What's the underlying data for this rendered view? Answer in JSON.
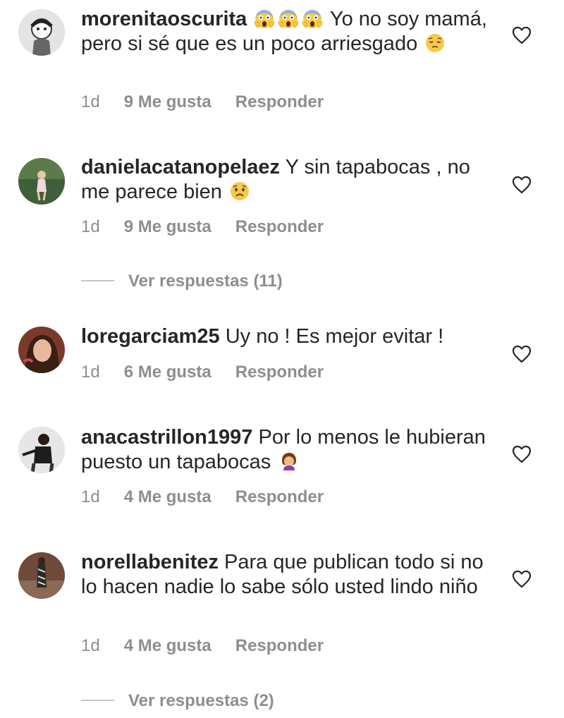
{
  "comments": [
    {
      "username": "morenitaoscurita",
      "text_parts": [
        " ",
        " Yo no soy mamá, pero si sé que es un poco arriesgado "
      ],
      "emojis_before": [
        "scream",
        "scream",
        "scream"
      ],
      "emoji_after": "pensive",
      "time": "1d",
      "likes": "9 Me gusta",
      "reply": "Responder"
    },
    {
      "username": "danielacatanopelaez",
      "text": " Y sin tapabocas , no me parece bien ",
      "emoji_after": "worried",
      "time": "1d",
      "likes": "9 Me gusta",
      "reply": "Responder",
      "view_replies": "Ver respuestas (11)"
    },
    {
      "username": "loregarciam25",
      "text": " Uy no ! Es mejor evitar !",
      "time": "1d",
      "likes": "6 Me gusta",
      "reply": "Responder"
    },
    {
      "username": "anacastrillon1997",
      "text": " Por lo menos le hubieran puesto un tapabocas ",
      "emoji_after": "facepalm",
      "time": "1d",
      "likes": "4 Me gusta",
      "reply": "Responder"
    },
    {
      "username": "norellabenitez",
      "text": " Para que publican todo si no lo hacen nadie lo sabe  sólo usted lindo niño",
      "time": "1d",
      "likes": "4 Me gusta",
      "reply": "Responder",
      "view_replies": "Ver respuestas (2)"
    }
  ],
  "colors": {
    "text": "#262626",
    "meta": "#8e8e8e",
    "divider": "#c7c7c7",
    "heart_outline": "#262626"
  },
  "icons": {
    "like": "heart-outline-icon",
    "avatar": "avatar-photo"
  }
}
